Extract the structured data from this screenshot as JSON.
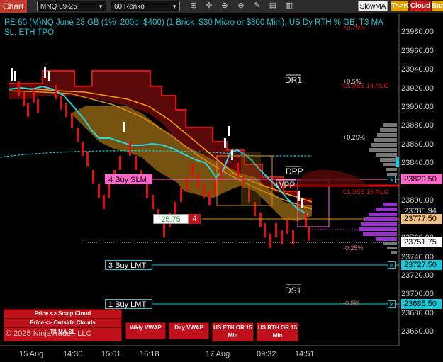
{
  "toolbar": {
    "chart_tab": "Chart",
    "instrument": "MNQ 09-25",
    "interval": "60 Renko",
    "strategy_value": "SlowMA",
    "btn_tk": "T<>K",
    "btn_cloud": "Cloud",
    "btn_bar": "Bar"
  },
  "title": "RE 60 (M)NQ June 23 GB (1%=200p=$400) (1 Brick=$30 Micro or $300 Mini), US Dy RTH % GB, T3 MA SL, ETH TPO",
  "axis": {
    "price_labels": [
      "23980.00",
      "23960.00",
      "23940.00",
      "23920.00",
      "23900.00",
      "23880.00",
      "23860.00",
      "23840.00",
      "23800.00",
      "23760.00",
      "23740.00",
      "23720.00",
      "23700.00",
      "23680.00",
      "23660.00"
    ],
    "time_labels": [
      "15 Aug",
      "14:30",
      "15:01",
      "16:18",
      "17 Aug",
      "09:32",
      "14:51"
    ]
  },
  "price_tags": {
    "buy_slm": "23820.50",
    "pos_high": "23785.94",
    "pos_entry": "23777.50",
    "last": "23751.75",
    "buy_3": "23727.50",
    "buy_1": "23685.50"
  },
  "orders": {
    "buy_slm": "4 Buy SLM",
    "buy_3": "3 Buy LMT",
    "buy_1": "1 Buy LMT",
    "position_pnl": "25.75",
    "position_qty": "4"
  },
  "levels": {
    "dr1": "DR1",
    "dpp": "DPP",
    "wpp": "WPP",
    "ds1": "DS1",
    "plus_075": "+0.75%",
    "plus_05": "+0.5%",
    "plus_025": "+0.25%",
    "minus_025": "-0.25%",
    "minus_05": "-0.5%",
    "close_14aug": "CLOSE 14 AUG",
    "close_15aug": "CLOSE 15 AUG"
  },
  "buttons": {
    "scalp_cloud": "Price <> Scalp Cloud",
    "outside_clouds": "Price <> Outside Clouds",
    "t3_ma_sl": "T3 MA SL",
    "wkly_vwap": "Wkly VWAP",
    "day_vwap": "Day VWAP",
    "us_eth_or": "US ETH OR 15 Min",
    "us_rth_or": "US RTH OR 15 Min"
  },
  "copyright": "© 2025 NinjaTrader, LLC",
  "colors": {
    "accent_cyan": "#19c8d8",
    "bear_red": "#e01010",
    "bull_white": "#ffffff",
    "cloud_orange": "#b8860b",
    "cloud_red": "#8b0000",
    "tpo_purple": "#9b30d0",
    "tag_pink": "#ff66cc"
  },
  "icons": [
    "lock-icon",
    "crosshair-icon",
    "zoom-in-icon",
    "zoom-out-icon",
    "pencil-icon",
    "template-icon",
    "properties-icon"
  ]
}
